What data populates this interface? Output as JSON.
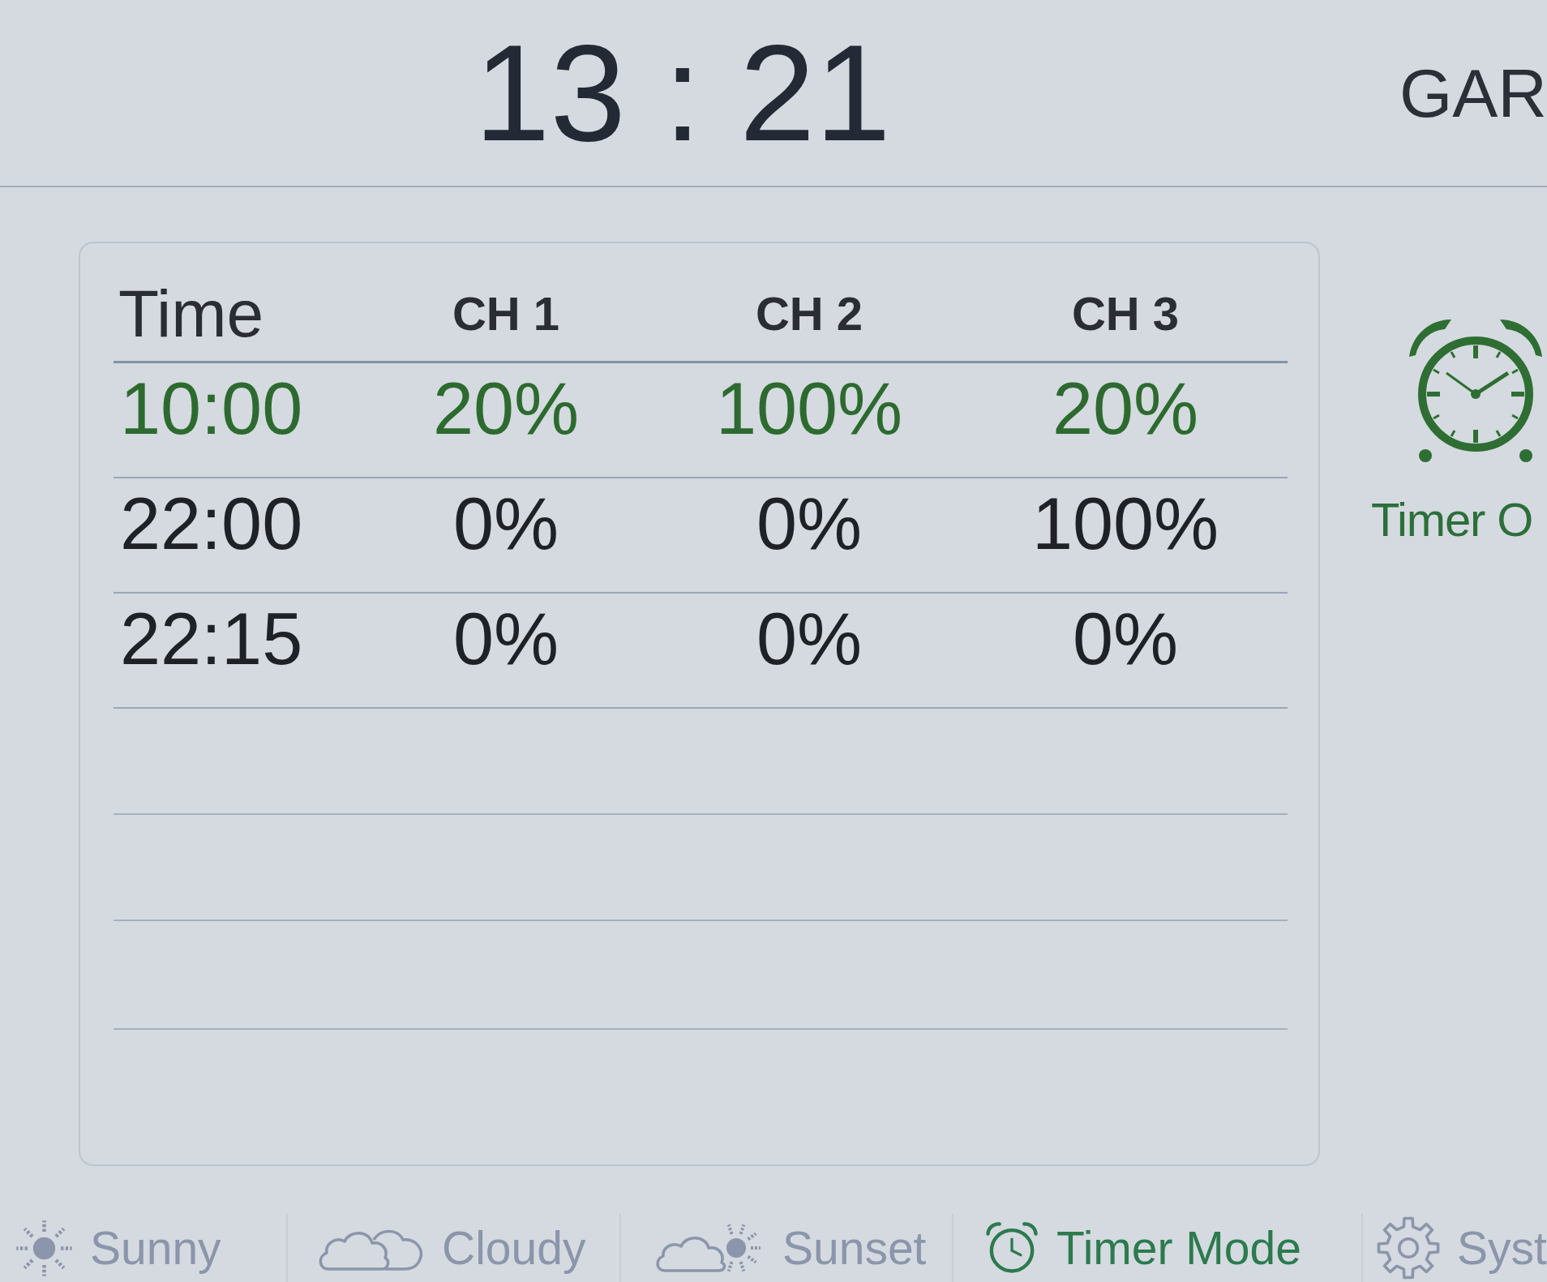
{
  "clock": {
    "time": "13 : 21"
  },
  "title": "GAR",
  "schedule": {
    "columns": [
      "Time",
      "CH 1",
      "CH 2",
      "CH 3"
    ],
    "rows": [
      {
        "active": true,
        "cells": [
          "10:00",
          "20%",
          "100%",
          "20%"
        ]
      },
      {
        "active": false,
        "cells": [
          "22:00",
          "0%",
          "0%",
          "100%"
        ]
      },
      {
        "active": false,
        "cells": [
          "22:15",
          "0%",
          "0%",
          "0%"
        ]
      }
    ]
  },
  "timer_status": {
    "label": "Timer O"
  },
  "nav": [
    {
      "kind": "sunny",
      "label": "Sunny",
      "selected": false
    },
    {
      "kind": "cloudy",
      "label": "Cloudy",
      "selected": false
    },
    {
      "kind": "sunset",
      "label": "Sunset",
      "selected": false
    },
    {
      "kind": "timer",
      "label": "Timer Mode",
      "selected": true
    },
    {
      "kind": "system",
      "label": "Syst",
      "selected": false
    }
  ]
}
